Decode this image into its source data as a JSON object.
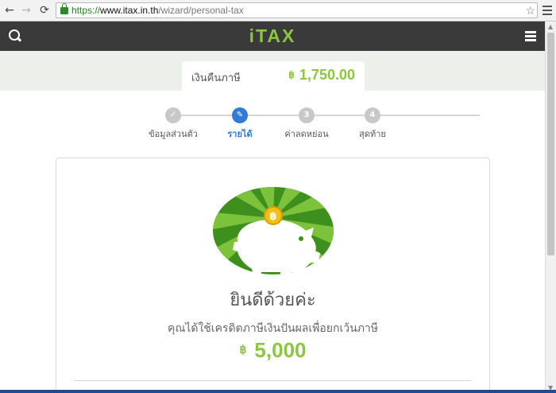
{
  "browser": {
    "url_scheme": "https://",
    "url_domain": "www.itax.in.th",
    "url_path": "/wizard/personal-tax",
    "back_glyph": "←",
    "forward_glyph": "→",
    "reload_glyph": "⟳",
    "star_glyph": "☆"
  },
  "header": {
    "logo": "iTAX"
  },
  "refund": {
    "label": "เงินคืนภาษี",
    "currency": "฿",
    "amount": "1,750.00"
  },
  "steps": [
    {
      "label": "ข้อมูลส่วนตัว",
      "marker": "✓",
      "state": "done"
    },
    {
      "label": "รายได้",
      "marker": "✎",
      "state": "active"
    },
    {
      "label": "ค่าลดหย่อน",
      "marker": "3",
      "state": "pending"
    },
    {
      "label": "สุดท้าย",
      "marker": "4",
      "state": "pending"
    }
  ],
  "card": {
    "title": "ยินดีด้วยค่ะ",
    "message": "คุณได้ใช้เครดิตภาษีเงินปันผลเพื่อยกเว้นภาษี",
    "currency": "฿",
    "amount": "5,000"
  },
  "colors": {
    "brand_green": "#8cc63f",
    "active_blue": "#2f7bd6",
    "header_dark": "#3a3a3a"
  },
  "icons": {
    "search": "search-icon",
    "menu": "hamburger-icon",
    "coin": "baht-coin-icon",
    "piggy": "piggy-bank-icon"
  }
}
